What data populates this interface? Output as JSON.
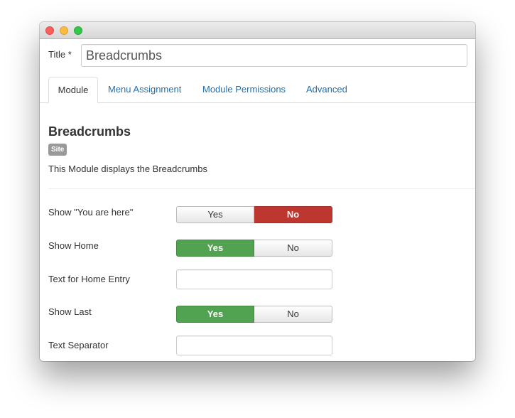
{
  "form": {
    "title_label": "Title *",
    "title_value": "Breadcrumbs"
  },
  "tabs": [
    {
      "label": "Module",
      "active": true
    },
    {
      "label": "Menu Assignment",
      "active": false
    },
    {
      "label": "Module Permissions",
      "active": false
    },
    {
      "label": "Advanced",
      "active": false
    }
  ],
  "module": {
    "heading": "Breadcrumbs",
    "badge": "Site",
    "description": "This Module displays the Breadcrumbs"
  },
  "fields": {
    "show_you_are_here": {
      "label": "Show \"You are here\"",
      "yes": "Yes",
      "no": "No",
      "selected": "No"
    },
    "show_home": {
      "label": "Show Home",
      "yes": "Yes",
      "no": "No",
      "selected": "Yes"
    },
    "text_home_entry": {
      "label": "Text for Home Entry",
      "value": ""
    },
    "show_last": {
      "label": "Show Last",
      "yes": "Yes",
      "no": "No",
      "selected": "Yes"
    },
    "text_separator": {
      "label": "Text Separator",
      "value": ""
    }
  },
  "colors": {
    "selected_no": "#bd362f",
    "selected_yes": "#51a351",
    "tab_link": "#1f6fad"
  }
}
